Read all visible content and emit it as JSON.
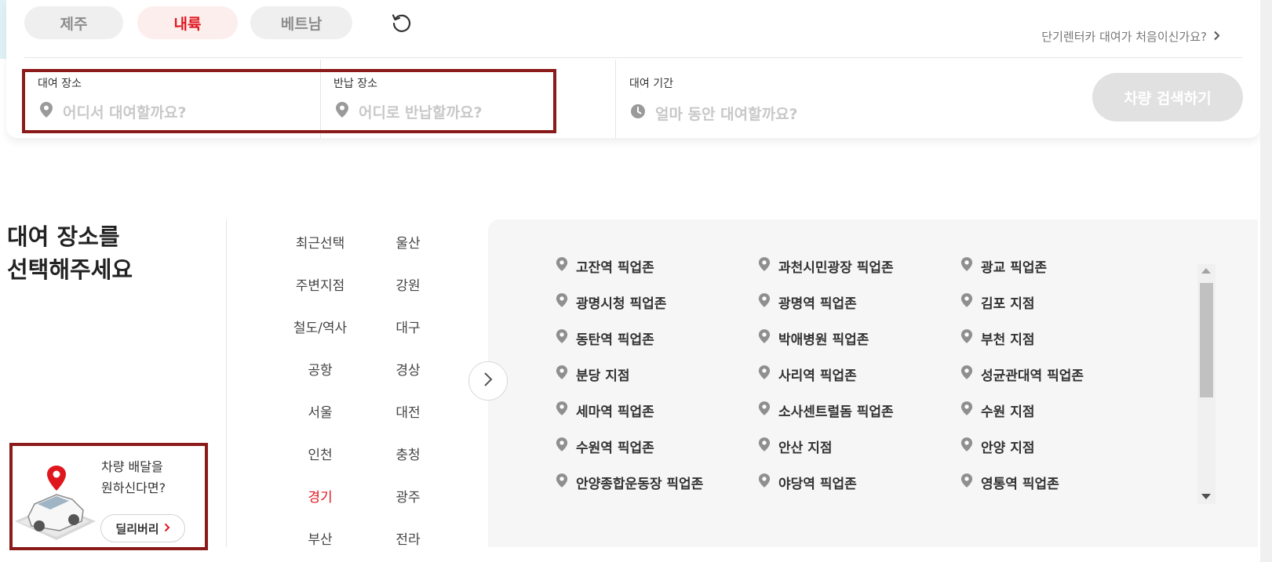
{
  "region_tabs": [
    {
      "label": "제주",
      "active": false
    },
    {
      "label": "내륙",
      "active": true
    },
    {
      "label": "베트남",
      "active": false
    }
  ],
  "reset_icon": "refresh-icon",
  "first_time_link": "단기렌터카 대여가 처음이신가요?",
  "search": {
    "pickup_label": "대여 장소",
    "pickup_placeholder": "어디서 대여할까요?",
    "return_label": "반납 장소",
    "return_placeholder": "어디로 반납할까요?",
    "period_label": "대여 기간",
    "period_placeholder": "얼마 동안 대여할까요?",
    "submit_label": "차량 검색하기"
  },
  "section_title": {
    "line1": "대여 장소를",
    "line2": "선택해주세요"
  },
  "delivery": {
    "line1": "차량 배달을",
    "line2": "원하신다면?",
    "button_label": "딜리버리"
  },
  "categories_left": [
    {
      "label": "최근선택",
      "active": false
    },
    {
      "label": "주변지점",
      "active": false
    },
    {
      "label": "철도/역사",
      "active": false
    },
    {
      "label": "공항",
      "active": false
    },
    {
      "label": "서울",
      "active": false
    },
    {
      "label": "인천",
      "active": false
    },
    {
      "label": "경기",
      "active": true
    },
    {
      "label": "부산",
      "active": false
    }
  ],
  "categories_right": [
    {
      "label": "울산",
      "active": false
    },
    {
      "label": "강원",
      "active": false
    },
    {
      "label": "대구",
      "active": false
    },
    {
      "label": "경상",
      "active": false
    },
    {
      "label": "대전",
      "active": false
    },
    {
      "label": "충청",
      "active": false
    },
    {
      "label": "광주",
      "active": false
    },
    {
      "label": "전라",
      "active": false
    }
  ],
  "branches": [
    [
      "고잔역 픽업존",
      "과천시민광장 픽업존",
      "광교 픽업존"
    ],
    [
      "광명시청 픽업존",
      "광명역 픽업존",
      "김포 지점"
    ],
    [
      "동탄역 픽업존",
      "박애병원 픽업존",
      "부천 지점"
    ],
    [
      "분당 지점",
      "사리역 픽업존",
      "성균관대역 픽업존"
    ],
    [
      "세마역 픽업존",
      "소사센트럴돔 픽업존",
      "수원 지점"
    ],
    [
      "수원역 픽업존",
      "안산 지점",
      "안양 지점"
    ],
    [
      "안양종합운동장 픽업존",
      "야당역 픽업존",
      "영통역 픽업존"
    ]
  ],
  "colors": {
    "brand_red": "#e0161e",
    "active_tab_bg": "#fdeeee",
    "disabled_button": "#e1e1e1",
    "highlight_frame": "#8b1a1a"
  }
}
